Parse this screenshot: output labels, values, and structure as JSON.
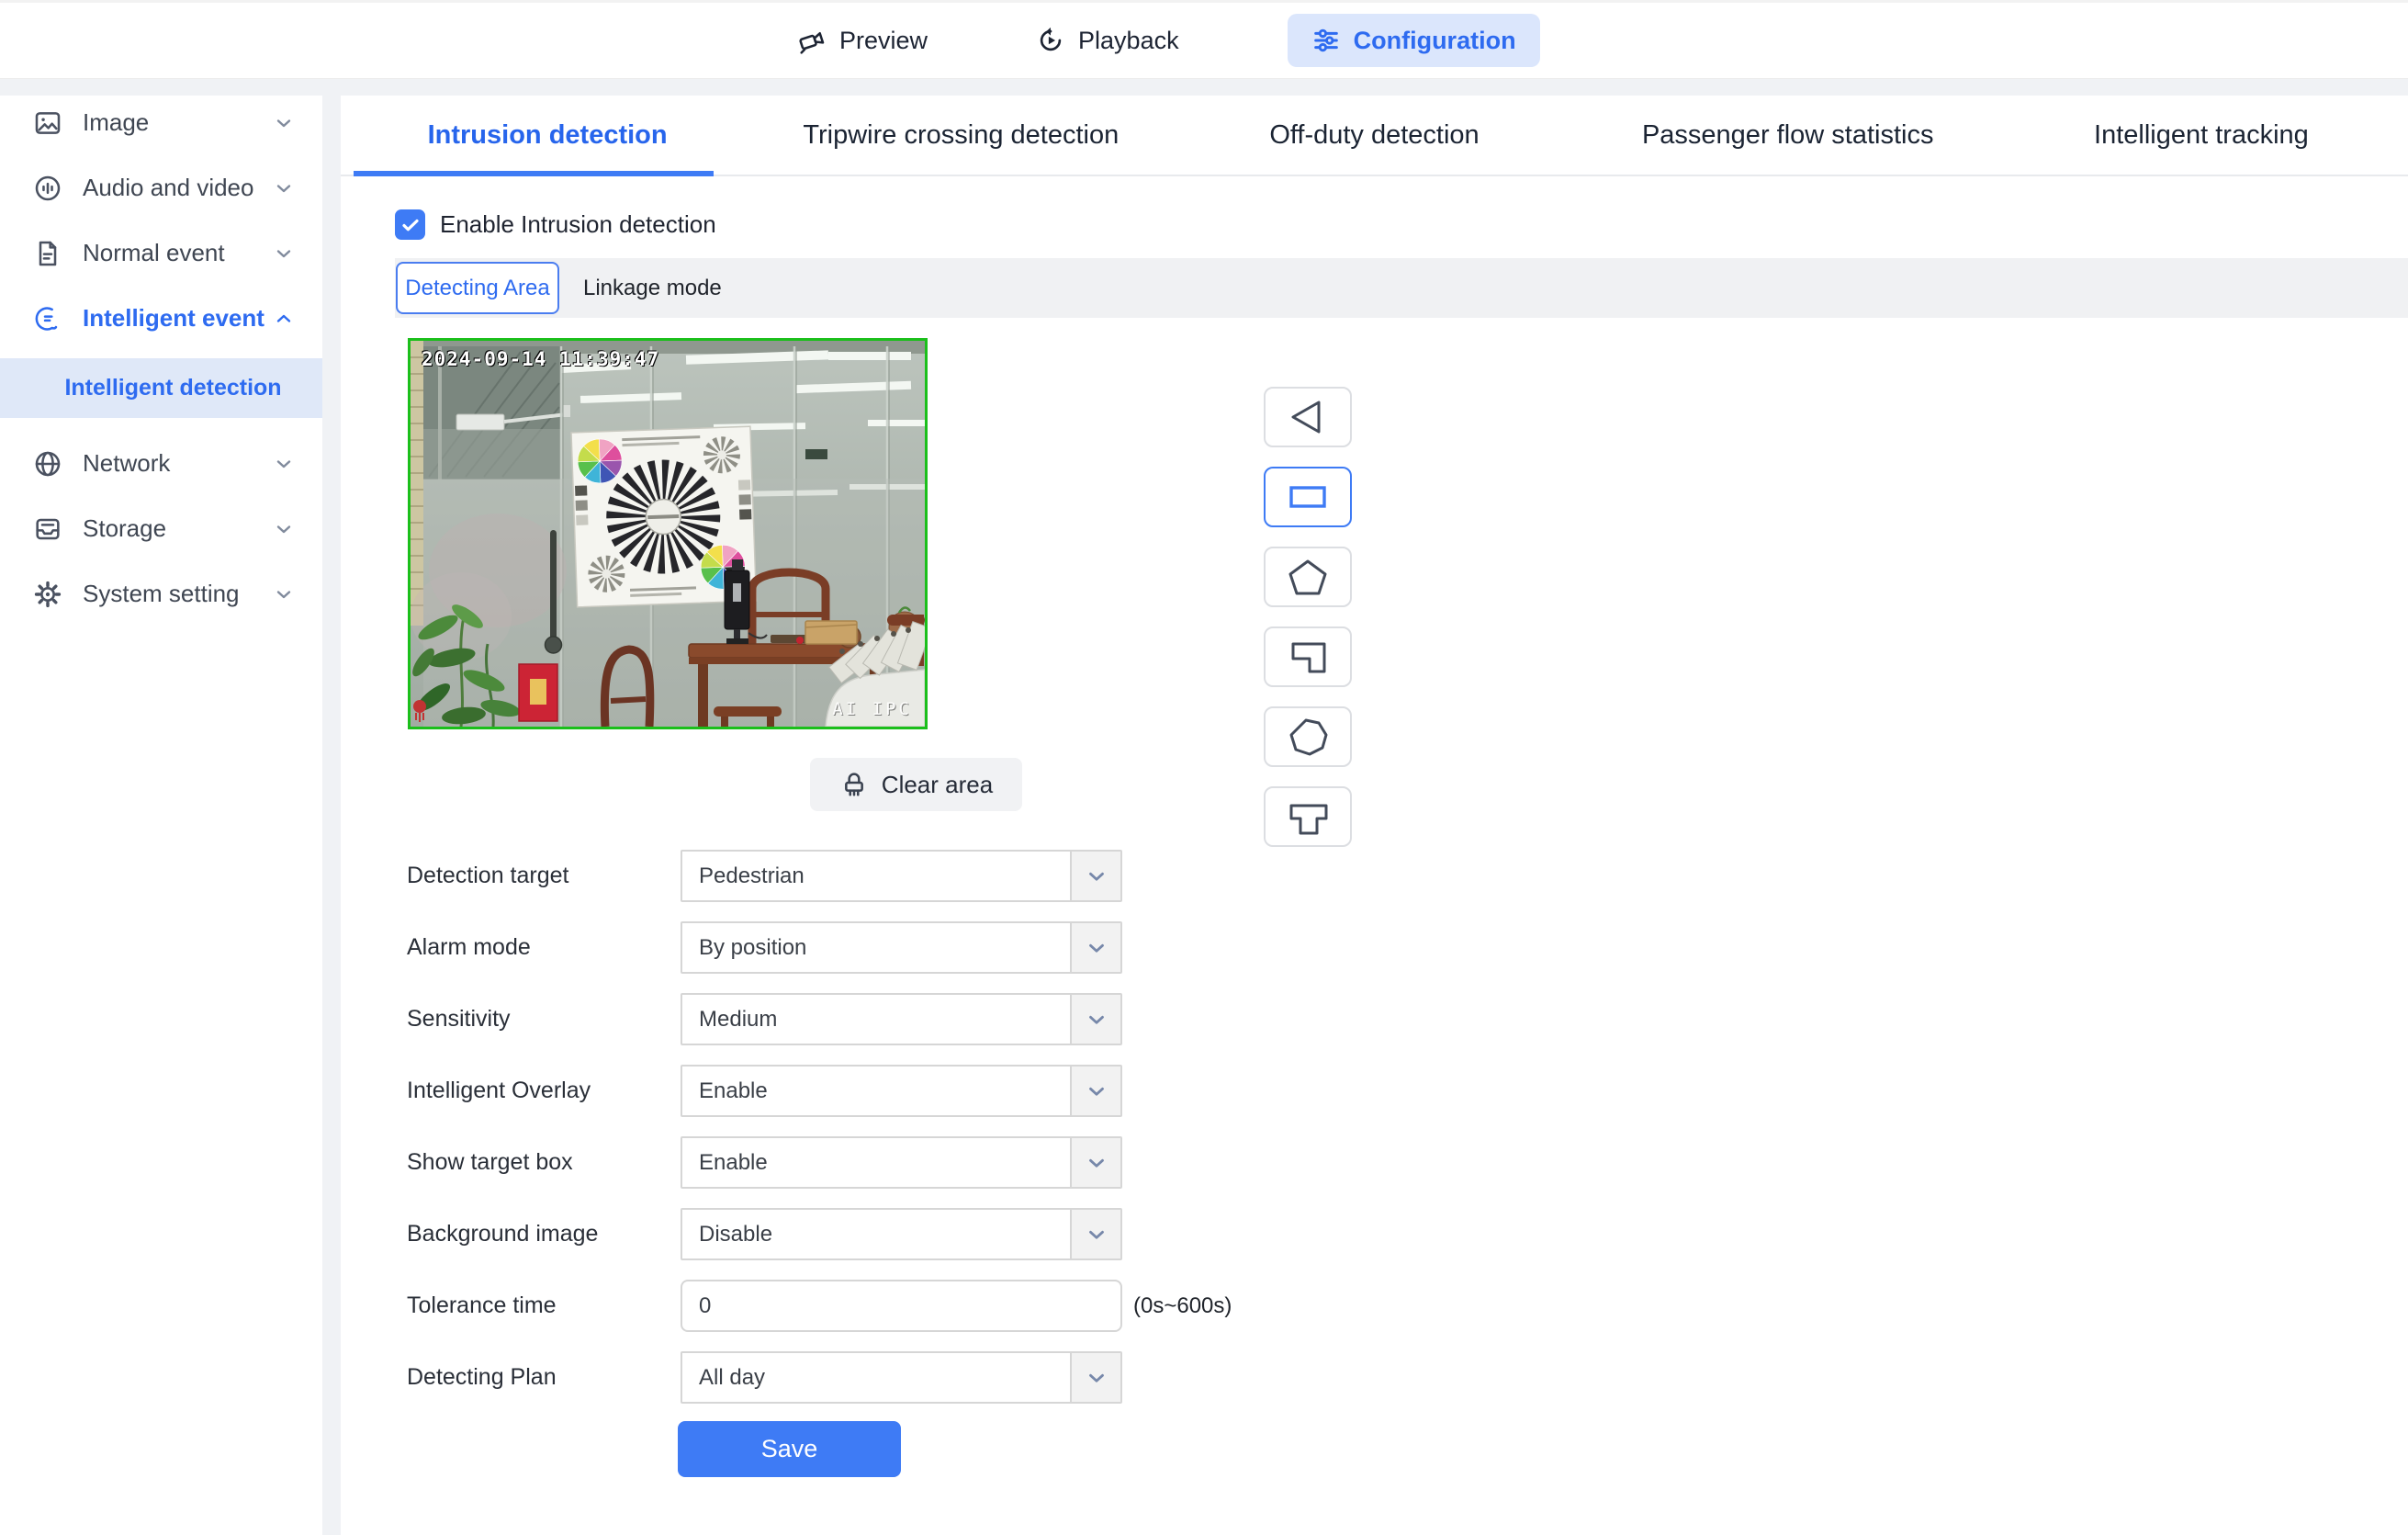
{
  "header": {
    "nav": [
      {
        "label": "Preview"
      },
      {
        "label": "Playback"
      },
      {
        "label": "Configuration"
      }
    ]
  },
  "sidebar": {
    "items": [
      {
        "label": "Image"
      },
      {
        "label": "Audio and video"
      },
      {
        "label": "Normal event"
      },
      {
        "label": "Intelligent event"
      },
      {
        "label": "Network"
      },
      {
        "label": "Storage"
      },
      {
        "label": "System setting"
      }
    ],
    "active_sub_item": "Intelligent detection"
  },
  "tabs": [
    {
      "label": "Intrusion detection",
      "active": true
    },
    {
      "label": "Tripwire crossing detection",
      "active": false
    },
    {
      "label": "Off-duty detection",
      "active": false
    },
    {
      "label": "Passenger flow statistics",
      "active": false
    },
    {
      "label": "Intelligent tracking",
      "active": false
    }
  ],
  "panel": {
    "enable_label": "Enable Intrusion detection",
    "enable_checked": true,
    "subtabs": [
      {
        "label": "Detecting Area",
        "active": true
      },
      {
        "label": "Linkage mode",
        "active": false
      }
    ],
    "video": {
      "timestamp": "2024-09-14 11:39:47",
      "watermark": "AI IPC",
      "border_color": "#1bbf1b"
    },
    "clear_area_label": "Clear area",
    "draw_tools": [
      "triangle-tool",
      "rectangle-tool",
      "pentagon-tool",
      "l-shape-tool",
      "heptagon-tool",
      "t-shape-tool"
    ],
    "selected_tool": "rectangle-tool",
    "form": {
      "detection_target": {
        "label": "Detection target",
        "value": "Pedestrian"
      },
      "alarm_mode": {
        "label": "Alarm mode",
        "value": "By position"
      },
      "sensitivity": {
        "label": "Sensitivity",
        "value": "Medium"
      },
      "intelligent_overlay": {
        "label": "Intelligent Overlay",
        "value": "Enable"
      },
      "show_target_box": {
        "label": "Show target box",
        "value": "Enable"
      },
      "background_image": {
        "label": "Background image",
        "value": "Disable"
      },
      "tolerance_time": {
        "label": "Tolerance time",
        "value": "0",
        "hint": "(0s~600s)"
      },
      "detecting_plan": {
        "label": "Detecting Plan",
        "value": "All day"
      }
    },
    "save_label": "Save"
  },
  "colors": {
    "primary": "#2e6bf0",
    "primary_bright": "#3e7bf5",
    "primary_light_bg": "#dbe6fc",
    "sidebar_active_bg": "#dfe8f8",
    "strip_bg": "#f0f1f3"
  }
}
